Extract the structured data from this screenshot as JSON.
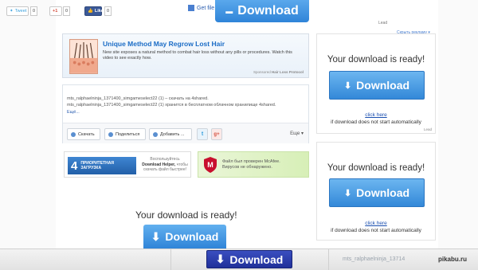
{
  "top_ad": {
    "get_file": "Get file",
    "download_label": "Download",
    "lead": "Lead",
    "ad_label": "Скрыть рекламу ▾"
  },
  "hair_ad": {
    "title": "Unique Method May Regrow Lost Hair",
    "description": "New site exposes a natural method to combat hair loss without any pills or procedures. Watch this video to see exactly how.",
    "brand_prefix": "Sponsored",
    "brand": "Hair Loss Protocol"
  },
  "file_panel": {
    "line1": "mts_ralphaelninja_1371400_simgameselect22 (1) – скачать на 4shared.",
    "line2": "mts_ralphaelninja_1371400_simgameselect22 (1) хранится в бесплатном облачном хранилище 4shared.",
    "more": "Ещё...",
    "buttons": {
      "download": "Скачать",
      "share": "Поделиться",
      "add": "Добавить ...",
      "twitter": "t",
      "gplus": "g+"
    },
    "more_menu": "Еще ▾"
  },
  "promo1": {
    "number": "4",
    "title_line1": "ПРИОРИТЕТНАЯ",
    "title_line2": "ЗАГРУЗКА",
    "side_line1": "Воспользуйтесь",
    "side_bold": "Download Helper,",
    "side_line2": "чтобы",
    "side_line3": "скачать файл быстрее!"
  },
  "promo2": {
    "line1": "Файл был проверен McAfee.",
    "line2": "Вирусов не обнаружено."
  },
  "bottom_ready": {
    "title": "Your download is ready!",
    "button": "Download"
  },
  "right_box_1": {
    "title": "Your download is ready!",
    "button": "Download",
    "link": "click here",
    "note": "if download does not start automatically",
    "lead": "Lead"
  },
  "right_box_2": {
    "title": "Your download is ready!",
    "button": "Download",
    "link": "click here",
    "note": "if download does not start automatically"
  },
  "bottom_bar": {
    "tweet": "Tweet",
    "tweet_count": "0",
    "gplus": "+1",
    "gplus_count": "0",
    "like": "Like",
    "like_count": "0",
    "download": "Download",
    "file_name": "mts_ralphaelninja_13714",
    "watermark": "pikabu.ru"
  }
}
